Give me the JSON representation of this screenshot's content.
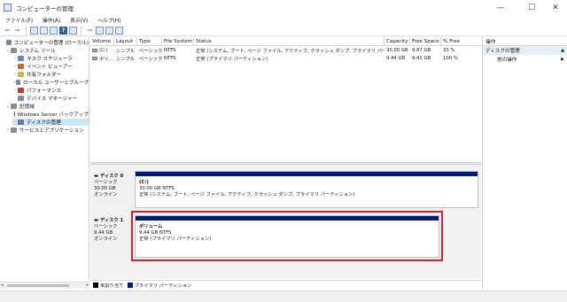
{
  "window": {
    "title": "コンピューターの管理",
    "controls": {
      "minimize": "—",
      "maximize": "☐",
      "close": "✕"
    }
  },
  "menu": [
    "ファイル(F)",
    "操作(A)",
    "表示(V)",
    "ヘルプ(H)"
  ],
  "tree": [
    {
      "label": "コンピューターの管理 (ローカル)",
      "arrow": "",
      "indent": 0,
      "color": "#6b86a8"
    },
    {
      "label": "システム ツール",
      "arrow": "⌄",
      "indent": 1,
      "color": "#8c8c8c"
    },
    {
      "label": "タスク スケジューラ",
      "arrow": "›",
      "indent": 2,
      "color": "#5d88c2"
    },
    {
      "label": "イベント ビューアー",
      "arrow": "›",
      "indent": 2,
      "color": "#c46b2f"
    },
    {
      "label": "共有フォルダー",
      "arrow": "›",
      "indent": 2,
      "color": "#d6b343"
    },
    {
      "label": "ローカル ユーザーとグループ",
      "arrow": "›",
      "indent": 2,
      "color": "#6d8fb6"
    },
    {
      "label": "パフォーマンス",
      "arrow": "›",
      "indent": 2,
      "color": "#c43a3a"
    },
    {
      "label": "デバイス マネージャー",
      "arrow": "",
      "indent": 2,
      "color": "#7f8fa0"
    },
    {
      "label": "記憶域",
      "arrow": "⌄",
      "indent": 1,
      "color": "#8c8c8c"
    },
    {
      "label": "Windows Server バックアップ",
      "arrow": "›",
      "indent": 2,
      "color": "#3f7a3f"
    },
    {
      "label": "ディスクの管理",
      "arrow": "",
      "indent": 2,
      "color": "#6b7b8f",
      "selected": true
    },
    {
      "label": "サービスとアプリケーション",
      "arrow": "›",
      "indent": 1,
      "color": "#8a8aa3"
    }
  ],
  "volumes": {
    "columns": [
      "Volume",
      "Layout",
      "Type",
      "File System",
      "Status",
      "Capacity",
      "Free Space",
      "% Free"
    ],
    "rows": [
      [
        "(C:)",
        "シンプル",
        "ベーシック",
        "NTFS",
        "正常 (システム, ブート, ページ ファイル, アクティブ, クラッシュ ダンプ, プライマリ パーティション)",
        "30.00 GB",
        "9.87 GB",
        "33 %"
      ],
      [
        "ボリ...",
        "シンプル",
        "ベーシック",
        "NTFS",
        "正常 (プライマリ パーティション)",
        "9.44 GB",
        "9.41 GB",
        "100 %"
      ]
    ]
  },
  "disks": [
    {
      "name": "ディスク 0",
      "type": "ベーシック",
      "size": "30.00 GB",
      "state": "オンライン",
      "partition": {
        "name": "(C:)",
        "size": "30.00 GB NTFS",
        "status": "正常 (システム, ブート, ページ ファイル, アクティブ, クラッシュ ダンプ, プライマリ パーティション)"
      }
    },
    {
      "name": "ディスク 1",
      "type": "ベーシック",
      "size": "9.44 GB",
      "state": "オンライン",
      "partition": {
        "name": "ボリューム",
        "size": "9.44 GB NTFS",
        "status": "正常 (プライマリ パーティション)"
      }
    }
  ],
  "legend": [
    {
      "label": "未割り当て",
      "color": "#000000"
    },
    {
      "label": "プライマリ パーティション",
      "color": "#001a7a"
    }
  ],
  "actions": {
    "header": "操作",
    "section": "ディスクの管理",
    "section_arrow": "▲",
    "item": "他の操作",
    "item_arrow": "▶"
  },
  "colors": {
    "primary_partition": "#001a7a",
    "highlight": "#d3202a",
    "selection": "#cce4f7"
  }
}
